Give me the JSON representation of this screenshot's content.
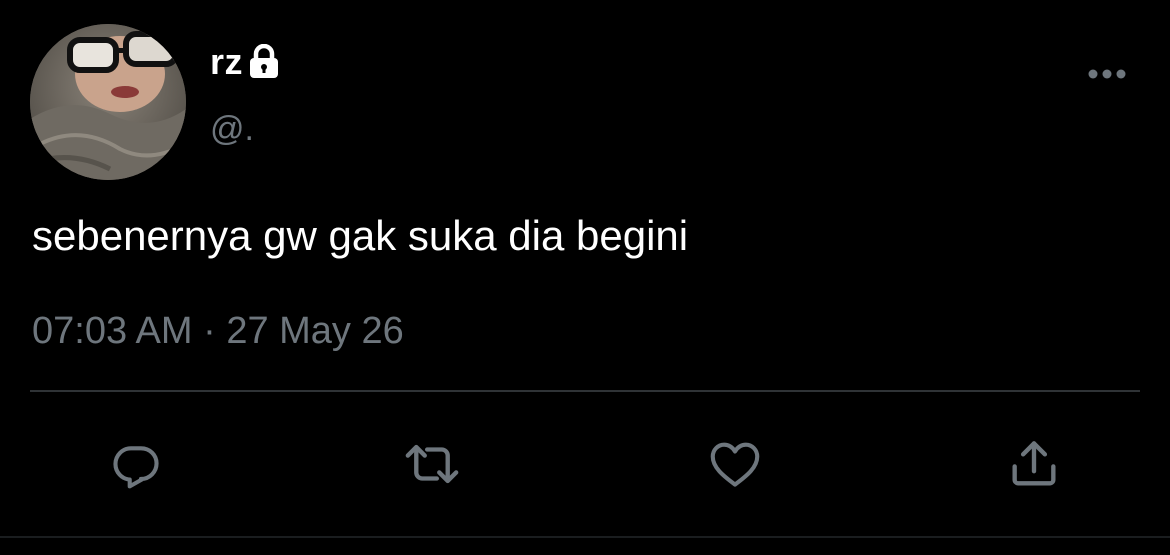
{
  "tweet": {
    "display_name": "rz",
    "protected_icon": "lock-icon",
    "handle": "@.",
    "text": "sebenernya gw gak suka dia begini",
    "timestamp": "07:03 AM · 27 May 26",
    "more_icon": "more-horizontal-icon"
  },
  "actions": [
    {
      "name": "reply",
      "icon": "reply-bubble-icon"
    },
    {
      "name": "retweet",
      "icon": "retweet-icon"
    },
    {
      "name": "like",
      "icon": "heart-icon"
    },
    {
      "name": "share",
      "icon": "share-upload-icon"
    }
  ],
  "colors": {
    "background": "#000000",
    "primary_text": "#ffffff",
    "secondary_text": "#6e767d",
    "divider": "#2f3336",
    "icon": "#6e767d"
  }
}
